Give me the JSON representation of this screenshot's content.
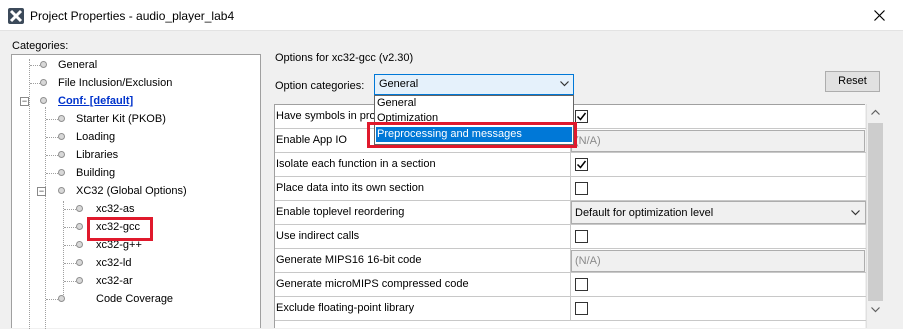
{
  "window": {
    "title": "Project Properties - audio_player_lab4",
    "app_icon": "x-logo-icon",
    "close_icon": "close-icon"
  },
  "categories": {
    "label": "Categories:",
    "items": [
      {
        "label": "General"
      },
      {
        "label": "File Inclusion/Exclusion"
      },
      {
        "label": "Conf: [default]"
      },
      {
        "label": "Starter Kit (PKOB)"
      },
      {
        "label": "Loading"
      },
      {
        "label": "Libraries"
      },
      {
        "label": "Building"
      },
      {
        "label": "XC32 (Global Options)"
      },
      {
        "label": "xc32-as"
      },
      {
        "label": "xc32-gcc"
      },
      {
        "label": "xc32-g++"
      },
      {
        "label": "xc32-ld"
      },
      {
        "label": "xc32-ar"
      },
      {
        "label": "Code Coverage"
      }
    ]
  },
  "options": {
    "options_for": "Options for xc32-gcc (v2.30)",
    "option_categories_label": "Option categories:",
    "selected_category": "General",
    "reset_label": "Reset",
    "dropdown_items": [
      "General",
      "Optimization",
      "Preprocessing and messages"
    ]
  },
  "grid": {
    "rows": [
      {
        "label": "Have symbols in prod",
        "value": "checked"
      },
      {
        "label": "Enable App IO",
        "value": "(N/A)"
      },
      {
        "label": "Isolate each function in a section",
        "value": "checked"
      },
      {
        "label": "Place data into its own section",
        "value": "unchecked"
      },
      {
        "label": "Enable toplevel reordering",
        "value": "Default for optimization level"
      },
      {
        "label": "Use indirect calls",
        "value": "unchecked"
      },
      {
        "label": "Generate MIPS16 16-bit code",
        "value": "(N/A)"
      },
      {
        "label": "Generate microMIPS compressed code",
        "value": "unchecked"
      },
      {
        "label": "Exclude floating-point library",
        "value": "unchecked"
      }
    ]
  },
  "colors": {
    "highlight_box": "#e0192c",
    "selection": "#0078d7",
    "link": "#0033cc"
  }
}
